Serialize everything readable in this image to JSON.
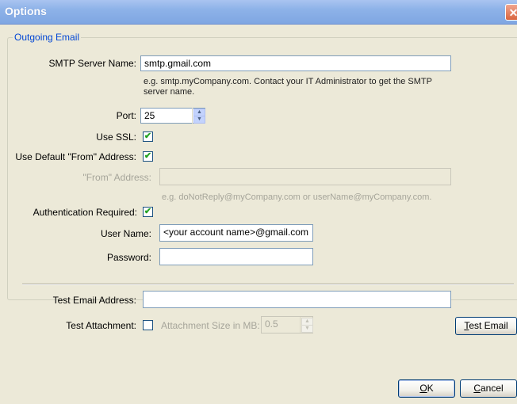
{
  "window": {
    "title": "Options",
    "close_glyph": "✕"
  },
  "group": {
    "title": "Outgoing Email"
  },
  "smtp": {
    "label": "SMTP Server Name:",
    "value": "smtp.gmail.com",
    "hint_line1": "e.g.  smtp.myCompany.com. Contact your IT Administrator to get the SMTP",
    "hint_line2": "server name."
  },
  "port": {
    "label": "Port:",
    "value": "25"
  },
  "ssl": {
    "label": "Use SSL:",
    "checked": true
  },
  "default_from": {
    "label": "Use Default \"From\" Address:",
    "checked": true
  },
  "from_address": {
    "label": "\"From\" Address:",
    "value": "",
    "hint": "e.g. doNotReply@myCompany.com or userName@myCompany.com."
  },
  "auth": {
    "label": "Authentication Required:",
    "checked": true
  },
  "username": {
    "label": "User Name:",
    "value": "<your account name>@gmail.com"
  },
  "password": {
    "label": "Password:",
    "value": ""
  },
  "test_email": {
    "label": "Test Email Address:",
    "value": ""
  },
  "test_attachment": {
    "label": "Test Attachment:",
    "checked": false,
    "size_label": "Attachment Size in MB:",
    "size_value": "0.5"
  },
  "buttons": {
    "test_email_mnemonic": "T",
    "test_email_rest": "est Email",
    "ok_mnemonic": "O",
    "ok_rest": "K",
    "cancel_mnemonic": "C",
    "cancel_rest": "ancel"
  },
  "glyphs": {
    "check": "✔",
    "spin_up": "▲",
    "spin_down": "▼"
  },
  "colors": {
    "title_bar": "#8db2e8",
    "group_title": "#0046d5",
    "dialog_bg": "#ece9d8",
    "close_button": "#d9653f"
  }
}
